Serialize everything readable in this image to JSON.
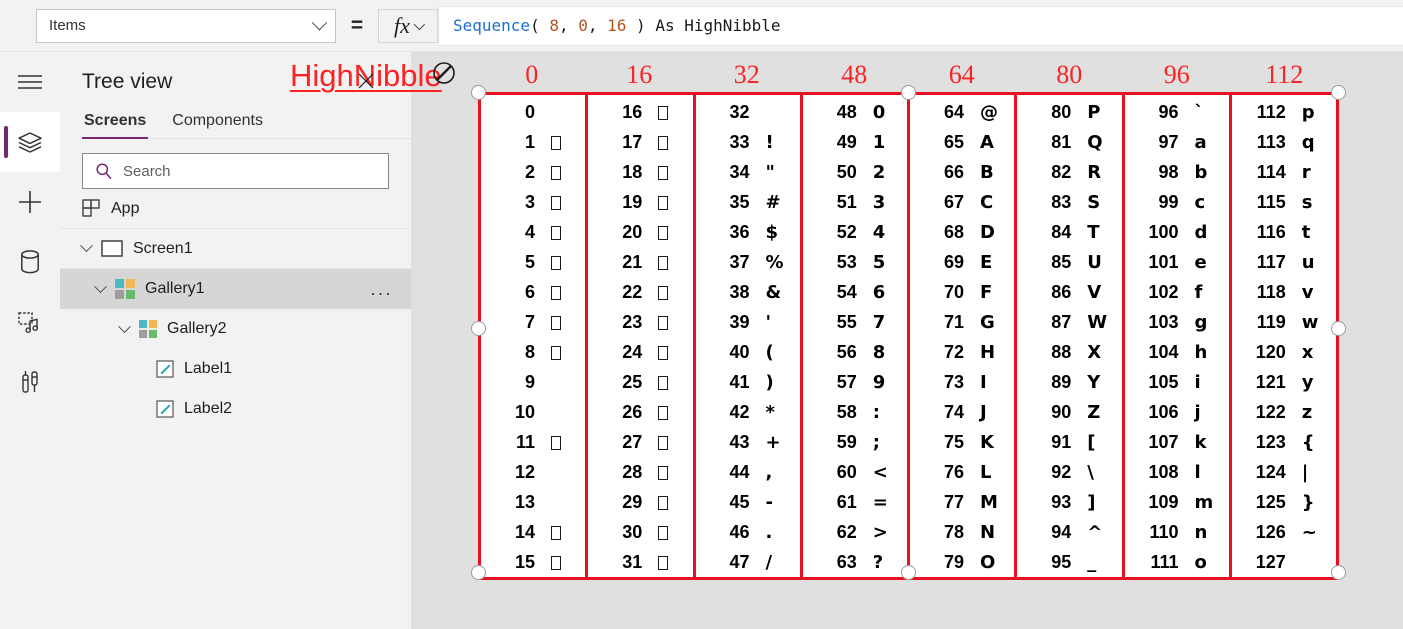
{
  "formula_bar": {
    "property_value": "Items",
    "equals": "=",
    "fx_label": "fx",
    "formula_tokens": [
      {
        "t": "Sequence",
        "k": "fn"
      },
      {
        "t": "( ",
        "k": "pun"
      },
      {
        "t": "8",
        "k": "num"
      },
      {
        "t": ", ",
        "k": "pun"
      },
      {
        "t": "0",
        "k": "num"
      },
      {
        "t": ", ",
        "k": "pun"
      },
      {
        "t": "16",
        "k": "num"
      },
      {
        "t": " ) ",
        "k": "pun"
      },
      {
        "t": "As HighNibble",
        "k": "kw"
      }
    ],
    "formula_text": "Sequence( 8, 0, 16 ) As HighNibble"
  },
  "icon_rail": {
    "items": [
      {
        "name": "hamburger-menu-icon",
        "active": false
      },
      {
        "name": "tree-view-layers-icon",
        "active": true
      },
      {
        "name": "insert-plus-icon",
        "active": false
      },
      {
        "name": "data-cylinder-icon",
        "active": false
      },
      {
        "name": "media-icon",
        "active": false
      },
      {
        "name": "advanced-tools-icon",
        "active": false
      }
    ]
  },
  "tree_panel": {
    "title": "Tree view",
    "tabs": [
      {
        "label": "Screens",
        "active": true
      },
      {
        "label": "Components",
        "active": false
      }
    ],
    "search": {
      "placeholder": "Search",
      "value": ""
    },
    "items": [
      {
        "label": "App",
        "indent": 0,
        "icon": "app-grid-icon",
        "expandable": false,
        "selected": false
      },
      {
        "label": "Screen1",
        "indent": 0,
        "icon": "screen-icon",
        "expandable": true,
        "selected": false
      },
      {
        "label": "Gallery1",
        "indent": 1,
        "icon": "gallery-icon",
        "expandable": true,
        "selected": true,
        "more": "..."
      },
      {
        "label": "Gallery2",
        "indent": 2,
        "icon": "gallery-icon",
        "expandable": true,
        "selected": false
      },
      {
        "label": "Label1",
        "indent": 3,
        "icon": "label-edit-icon",
        "expandable": false,
        "selected": false
      },
      {
        "label": "Label2",
        "indent": 3,
        "icon": "label-edit-icon",
        "expandable": false,
        "selected": false
      }
    ]
  },
  "canvas": {
    "overlay_label": "HighNibble",
    "overlay_label_color": "#fb2323",
    "selection_border_color": "#e81123",
    "column_headers": [
      "0",
      "16",
      "32",
      "48",
      "64",
      "80",
      "96",
      "112"
    ],
    "columns": [
      {
        "header": "0",
        "rows": [
          {
            "num": "0",
            "char": "",
            "tofu": false
          },
          {
            "num": "1",
            "char": "",
            "tofu": true
          },
          {
            "num": "2",
            "char": "",
            "tofu": true
          },
          {
            "num": "3",
            "char": "",
            "tofu": true
          },
          {
            "num": "4",
            "char": "",
            "tofu": true
          },
          {
            "num": "5",
            "char": "",
            "tofu": true
          },
          {
            "num": "6",
            "char": "",
            "tofu": true
          },
          {
            "num": "7",
            "char": "",
            "tofu": true
          },
          {
            "num": "8",
            "char": "",
            "tofu": true
          },
          {
            "num": "9",
            "char": "",
            "tofu": false
          },
          {
            "num": "10",
            "char": "",
            "tofu": false
          },
          {
            "num": "11",
            "char": "",
            "tofu": true
          },
          {
            "num": "12",
            "char": "",
            "tofu": false
          },
          {
            "num": "13",
            "char": "",
            "tofu": false
          },
          {
            "num": "14",
            "char": "",
            "tofu": true
          },
          {
            "num": "15",
            "char": "",
            "tofu": true
          }
        ]
      },
      {
        "header": "16",
        "rows": [
          {
            "num": "16",
            "char": "",
            "tofu": true
          },
          {
            "num": "17",
            "char": "",
            "tofu": true
          },
          {
            "num": "18",
            "char": "",
            "tofu": true
          },
          {
            "num": "19",
            "char": "",
            "tofu": true
          },
          {
            "num": "20",
            "char": "",
            "tofu": true
          },
          {
            "num": "21",
            "char": "",
            "tofu": true
          },
          {
            "num": "22",
            "char": "",
            "tofu": true
          },
          {
            "num": "23",
            "char": "",
            "tofu": true
          },
          {
            "num": "24",
            "char": "",
            "tofu": true
          },
          {
            "num": "25",
            "char": "",
            "tofu": true
          },
          {
            "num": "26",
            "char": "",
            "tofu": true
          },
          {
            "num": "27",
            "char": "",
            "tofu": true
          },
          {
            "num": "28",
            "char": "",
            "tofu": true
          },
          {
            "num": "29",
            "char": "",
            "tofu": true
          },
          {
            "num": "30",
            "char": "",
            "tofu": true
          },
          {
            "num": "31",
            "char": "",
            "tofu": true
          }
        ]
      },
      {
        "header": "32",
        "rows": [
          {
            "num": "32",
            "char": "",
            "tofu": false
          },
          {
            "num": "33",
            "char": "!",
            "tofu": false
          },
          {
            "num": "34",
            "char": "\"",
            "tofu": false
          },
          {
            "num": "35",
            "char": "#",
            "tofu": false
          },
          {
            "num": "36",
            "char": "$",
            "tofu": false
          },
          {
            "num": "37",
            "char": "%",
            "tofu": false
          },
          {
            "num": "38",
            "char": "&",
            "tofu": false
          },
          {
            "num": "39",
            "char": "'",
            "tofu": false
          },
          {
            "num": "40",
            "char": "(",
            "tofu": false
          },
          {
            "num": "41",
            "char": ")",
            "tofu": false
          },
          {
            "num": "42",
            "char": "*",
            "tofu": false
          },
          {
            "num": "43",
            "char": "+",
            "tofu": false
          },
          {
            "num": "44",
            "char": ",",
            "tofu": false
          },
          {
            "num": "45",
            "char": "-",
            "tofu": false
          },
          {
            "num": "46",
            "char": ".",
            "tofu": false
          },
          {
            "num": "47",
            "char": "/",
            "tofu": false
          }
        ]
      },
      {
        "header": "48",
        "rows": [
          {
            "num": "48",
            "char": "0",
            "tofu": false
          },
          {
            "num": "49",
            "char": "1",
            "tofu": false
          },
          {
            "num": "50",
            "char": "2",
            "tofu": false
          },
          {
            "num": "51",
            "char": "3",
            "tofu": false
          },
          {
            "num": "52",
            "char": "4",
            "tofu": false
          },
          {
            "num": "53",
            "char": "5",
            "tofu": false
          },
          {
            "num": "54",
            "char": "6",
            "tofu": false
          },
          {
            "num": "55",
            "char": "7",
            "tofu": false
          },
          {
            "num": "56",
            "char": "8",
            "tofu": false
          },
          {
            "num": "57",
            "char": "9",
            "tofu": false
          },
          {
            "num": "58",
            "char": ":",
            "tofu": false
          },
          {
            "num": "59",
            "char": ";",
            "tofu": false
          },
          {
            "num": "60",
            "char": "<",
            "tofu": false
          },
          {
            "num": "61",
            "char": "=",
            "tofu": false
          },
          {
            "num": "62",
            "char": ">",
            "tofu": false
          },
          {
            "num": "63",
            "char": "?",
            "tofu": false
          }
        ]
      },
      {
        "header": "64",
        "rows": [
          {
            "num": "64",
            "char": "@",
            "tofu": false
          },
          {
            "num": "65",
            "char": "A",
            "tofu": false
          },
          {
            "num": "66",
            "char": "B",
            "tofu": false
          },
          {
            "num": "67",
            "char": "C",
            "tofu": false
          },
          {
            "num": "68",
            "char": "D",
            "tofu": false
          },
          {
            "num": "69",
            "char": "E",
            "tofu": false
          },
          {
            "num": "70",
            "char": "F",
            "tofu": false
          },
          {
            "num": "71",
            "char": "G",
            "tofu": false
          },
          {
            "num": "72",
            "char": "H",
            "tofu": false
          },
          {
            "num": "73",
            "char": "I",
            "tofu": false
          },
          {
            "num": "74",
            "char": "J",
            "tofu": false
          },
          {
            "num": "75",
            "char": "K",
            "tofu": false
          },
          {
            "num": "76",
            "char": "L",
            "tofu": false
          },
          {
            "num": "77",
            "char": "M",
            "tofu": false
          },
          {
            "num": "78",
            "char": "N",
            "tofu": false
          },
          {
            "num": "79",
            "char": "O",
            "tofu": false
          }
        ]
      },
      {
        "header": "80",
        "rows": [
          {
            "num": "80",
            "char": "P",
            "tofu": false
          },
          {
            "num": "81",
            "char": "Q",
            "tofu": false
          },
          {
            "num": "82",
            "char": "R",
            "tofu": false
          },
          {
            "num": "83",
            "char": "S",
            "tofu": false
          },
          {
            "num": "84",
            "char": "T",
            "tofu": false
          },
          {
            "num": "85",
            "char": "U",
            "tofu": false
          },
          {
            "num": "86",
            "char": "V",
            "tofu": false
          },
          {
            "num": "87",
            "char": "W",
            "tofu": false
          },
          {
            "num": "88",
            "char": "X",
            "tofu": false
          },
          {
            "num": "89",
            "char": "Y",
            "tofu": false
          },
          {
            "num": "90",
            "char": "Z",
            "tofu": false
          },
          {
            "num": "91",
            "char": "[",
            "tofu": false
          },
          {
            "num": "92",
            "char": "\\",
            "tofu": false
          },
          {
            "num": "93",
            "char": "]",
            "tofu": false
          },
          {
            "num": "94",
            "char": "^",
            "tofu": false
          },
          {
            "num": "95",
            "char": "_",
            "tofu": false
          }
        ]
      },
      {
        "header": "96",
        "rows": [
          {
            "num": "96",
            "char": "`",
            "tofu": false
          },
          {
            "num": "97",
            "char": "a",
            "tofu": false
          },
          {
            "num": "98",
            "char": "b",
            "tofu": false
          },
          {
            "num": "99",
            "char": "c",
            "tofu": false
          },
          {
            "num": "100",
            "char": "d",
            "tofu": false
          },
          {
            "num": "101",
            "char": "e",
            "tofu": false
          },
          {
            "num": "102",
            "char": "f",
            "tofu": false
          },
          {
            "num": "103",
            "char": "g",
            "tofu": false
          },
          {
            "num": "104",
            "char": "h",
            "tofu": false
          },
          {
            "num": "105",
            "char": "i",
            "tofu": false
          },
          {
            "num": "106",
            "char": "j",
            "tofu": false
          },
          {
            "num": "107",
            "char": "k",
            "tofu": false
          },
          {
            "num": "108",
            "char": "l",
            "tofu": false
          },
          {
            "num": "109",
            "char": "m",
            "tofu": false
          },
          {
            "num": "110",
            "char": "n",
            "tofu": false
          },
          {
            "num": "111",
            "char": "o",
            "tofu": false
          }
        ]
      },
      {
        "header": "112",
        "rows": [
          {
            "num": "112",
            "char": "p",
            "tofu": false
          },
          {
            "num": "113",
            "char": "q",
            "tofu": false
          },
          {
            "num": "114",
            "char": "r",
            "tofu": false
          },
          {
            "num": "115",
            "char": "s",
            "tofu": false
          },
          {
            "num": "116",
            "char": "t",
            "tofu": false
          },
          {
            "num": "117",
            "char": "u",
            "tofu": false
          },
          {
            "num": "118",
            "char": "v",
            "tofu": false
          },
          {
            "num": "119",
            "char": "w",
            "tofu": false
          },
          {
            "num": "120",
            "char": "x",
            "tofu": false
          },
          {
            "num": "121",
            "char": "y",
            "tofu": false
          },
          {
            "num": "122",
            "char": "z",
            "tofu": false
          },
          {
            "num": "123",
            "char": "{",
            "tofu": false
          },
          {
            "num": "124",
            "char": "|",
            "tofu": false
          },
          {
            "num": "125",
            "char": "}",
            "tofu": false
          },
          {
            "num": "126",
            "char": "~",
            "tofu": false
          },
          {
            "num": "127",
            "char": "",
            "tofu": false
          }
        ]
      }
    ]
  },
  "colors": {
    "accent": "#742774",
    "selection_red": "#e81123",
    "label_red": "#fb2323",
    "panel_bg": "#f2f2f2",
    "canvas_bg": "#e0e0e0"
  }
}
